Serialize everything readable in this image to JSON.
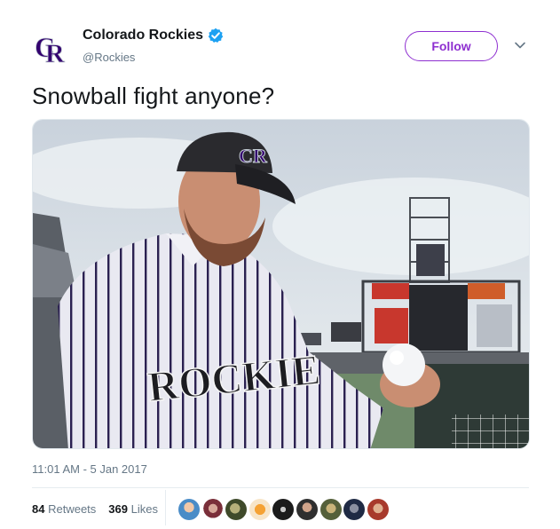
{
  "account": {
    "display_name": "Colorado Rockies",
    "handle": "@Rockies",
    "logo_text": "CR",
    "verified": true
  },
  "follow_button": {
    "label": "Follow"
  },
  "menu": {
    "icon": "chevron-down-icon"
  },
  "tweet": {
    "text": "Snowball fight anyone?"
  },
  "media": {
    "description_icons": [
      "photo"
    ],
    "jersey_text": "ROCKIE"
  },
  "timestamp": "11:01 AM - 5 Jan 2017",
  "stats": {
    "retweets_count": "84",
    "retweets_label": "Retweets",
    "likes_count": "369",
    "likes_label": "Likes"
  },
  "likers": [
    {
      "name": "liker-1"
    },
    {
      "name": "liker-2"
    },
    {
      "name": "liker-3"
    },
    {
      "name": "liker-4"
    },
    {
      "name": "liker-5"
    },
    {
      "name": "liker-6"
    },
    {
      "name": "liker-7"
    },
    {
      "name": "liker-8"
    },
    {
      "name": "liker-9"
    }
  ],
  "colors": {
    "brand_purple": "#8e2fd0",
    "verified_blue": "#1da1f2",
    "text_secondary": "#657786"
  }
}
